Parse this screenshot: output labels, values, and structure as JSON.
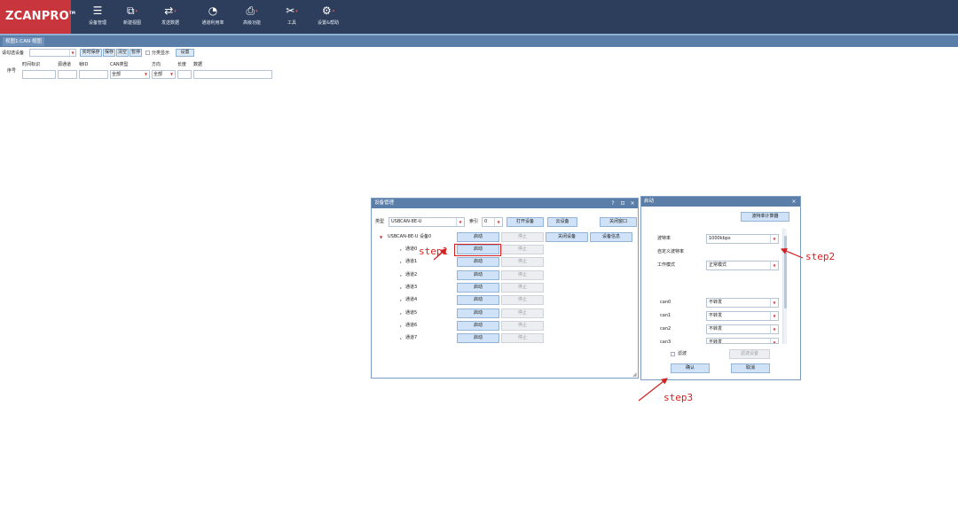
{
  "app": {
    "logo_text": "ZCANPRO",
    "logo_tm": "TM"
  },
  "toolbar": {
    "items": [
      {
        "label": "设备管理",
        "icon": "device-manage-icon",
        "glyph": "☰",
        "caret": false
      },
      {
        "label": "新建视图",
        "icon": "new-view-icon",
        "glyph": "⧉",
        "caret": true
      },
      {
        "label": "发送数据",
        "icon": "send-data-icon",
        "glyph": "⇄",
        "caret": true
      },
      {
        "label": "通道利用率",
        "icon": "channel-usage-icon",
        "glyph": "◔",
        "caret": false
      },
      {
        "label": "高级功能",
        "icon": "advanced-icon",
        "glyph": "⎙",
        "caret": true
      },
      {
        "label": "工具",
        "icon": "tools-icon",
        "glyph": "✂",
        "caret": true
      },
      {
        "label": "设置&帮助",
        "icon": "settings-help-icon",
        "glyph": "⚙",
        "caret": true
      }
    ]
  },
  "view_tab": "视图1:CAN 视图",
  "view_toolbar": {
    "select_device_label": "请勾选设备",
    "device_value": "",
    "realtime_save": "实时保存",
    "save": "保存",
    "clear": "清空",
    "pause": "暂停",
    "classify_display": "分类显示",
    "settings": "设置"
  },
  "filter_header": {
    "index": "序号",
    "timestamp": "时间标识",
    "source_channel": "源通道",
    "frame_id": "帧ID",
    "can_type": "CAN类型",
    "direction": "方向",
    "length": "长度",
    "data": "数据",
    "can_type_value": "全部",
    "direction_value": "全部"
  },
  "device_dialog": {
    "title": "设备管理",
    "ctrl_help": "?",
    "ctrl_restore": "⊡",
    "ctrl_close": "×",
    "type_label": "类型",
    "type_value": "USBCAN-8E-U",
    "index_label": "索引",
    "index_value": "0",
    "open_device": "打开设备",
    "cloud_device": "云设备",
    "close_window": "关闭窗口",
    "device_name": "USBCAN-8E-U 设备0",
    "device_start": "启动",
    "device_stop": "停止",
    "close_device": "关闭设备",
    "device_info": "设备信息",
    "channels": [
      {
        "name": "通道0",
        "start": "启动",
        "stop": "停止"
      },
      {
        "name": "通道1",
        "start": "启动",
        "stop": "停止"
      },
      {
        "name": "通道2",
        "start": "启动",
        "stop": "停止"
      },
      {
        "name": "通道3",
        "start": "启动",
        "stop": "停止"
      },
      {
        "name": "通道4",
        "start": "启动",
        "stop": "停止"
      },
      {
        "name": "通道5",
        "start": "启动",
        "stop": "停止"
      },
      {
        "name": "通道6",
        "start": "启动",
        "stop": "停止"
      },
      {
        "name": "通道7",
        "start": "启动",
        "stop": "停止"
      }
    ]
  },
  "start_dialog": {
    "title": "启动",
    "ctrl_close": "×",
    "baud_calc": "波特率计算器",
    "baud_label": "波特率",
    "baud_value": "1000kbps",
    "custom_baud_label": "自定义波特率",
    "work_mode_label": "工作模式",
    "work_mode_value": "正常模式",
    "can_rows": [
      {
        "label": "can0",
        "value": "不转发"
      },
      {
        "label": "can1",
        "value": "不转发"
      },
      {
        "label": "can2",
        "value": "不转发"
      },
      {
        "label": "can3",
        "value": "不转发"
      }
    ],
    "filter_label": "滤波",
    "filter_settings": "滤波设置",
    "confirm": "确认",
    "cancel": "取消"
  },
  "annotations": {
    "step1": "step1",
    "step2": "step2",
    "step3": "step3"
  },
  "colors": {
    "topbar": "#2c3e5c",
    "logo_bg": "#c9353c",
    "title_bar": "#5b7ea8",
    "button": "#cfe2f7",
    "annotation": "#d42020"
  }
}
